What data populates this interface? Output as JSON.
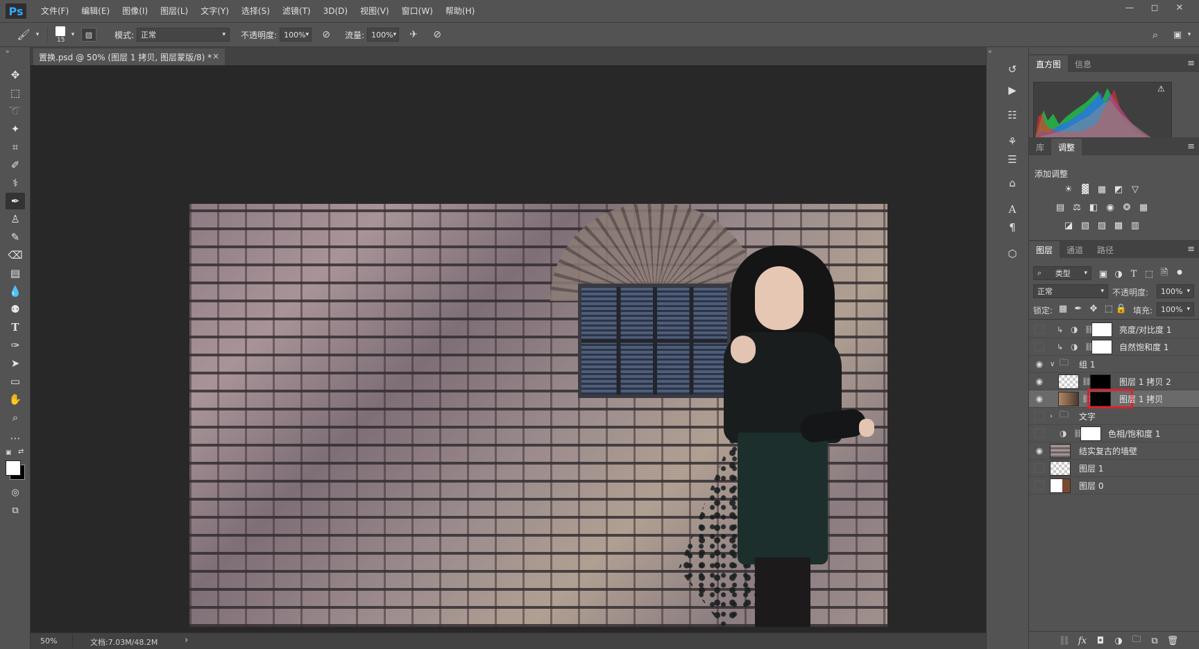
{
  "app": {
    "logo": "Ps"
  },
  "menu": [
    "文件(F)",
    "编辑(E)",
    "图像(I)",
    "图层(L)",
    "文字(Y)",
    "选择(S)",
    "滤镜(T)",
    "3D(D)",
    "视图(V)",
    "窗口(W)",
    "帮助(H)"
  ],
  "window_controls": {
    "minimize": "—",
    "maximize": "◻",
    "close": "✕"
  },
  "options": {
    "brush_size": "15",
    "mode_label": "模式:",
    "mode_value": "正常",
    "opacity_label": "不透明度:",
    "opacity_value": "100%",
    "flow_label": "流量:",
    "flow_value": "100%"
  },
  "document": {
    "tab_title": "置换.psd @ 50% (图层 1 拷贝, 图层蒙版/8) *",
    "tab_close": "×",
    "zoom": "50%",
    "doc_info": "文档:7.03M/48.2M",
    "status_arrow": "›"
  },
  "panels": {
    "histogram_tabs": [
      "直方图",
      "信息"
    ],
    "histogram_warning": "⚠",
    "adjust_tabs": [
      "库",
      "调整"
    ],
    "adjust_title": "添加调整",
    "layers_tabs": [
      "图层",
      "通道",
      "路径"
    ],
    "filter_kind": "类型",
    "blend_mode": "正常",
    "opacity_label": "不透明度:",
    "opacity_value": "100%",
    "lock_label": "锁定:",
    "fill_label": "填充:",
    "fill_value": "100%"
  },
  "layers": [
    {
      "name": "亮度/对比度 1",
      "visible": false
    },
    {
      "name": "自然饱和度 1",
      "visible": false
    },
    {
      "name": "组 1",
      "visible": true
    },
    {
      "name": "图层 1 拷贝 2",
      "visible": true
    },
    {
      "name": "图层 1 拷贝",
      "visible": true
    },
    {
      "name": "文字",
      "visible": false
    },
    {
      "name": "色相/饱和度 1",
      "visible": false
    },
    {
      "name": "结实复古的墙壁",
      "visible": true
    },
    {
      "name": "图层 1",
      "visible": false
    },
    {
      "name": "图层 0",
      "visible": false
    }
  ],
  "colors": {
    "highlight_box": "#e0202a",
    "ps_blue": "#31a8ff"
  }
}
